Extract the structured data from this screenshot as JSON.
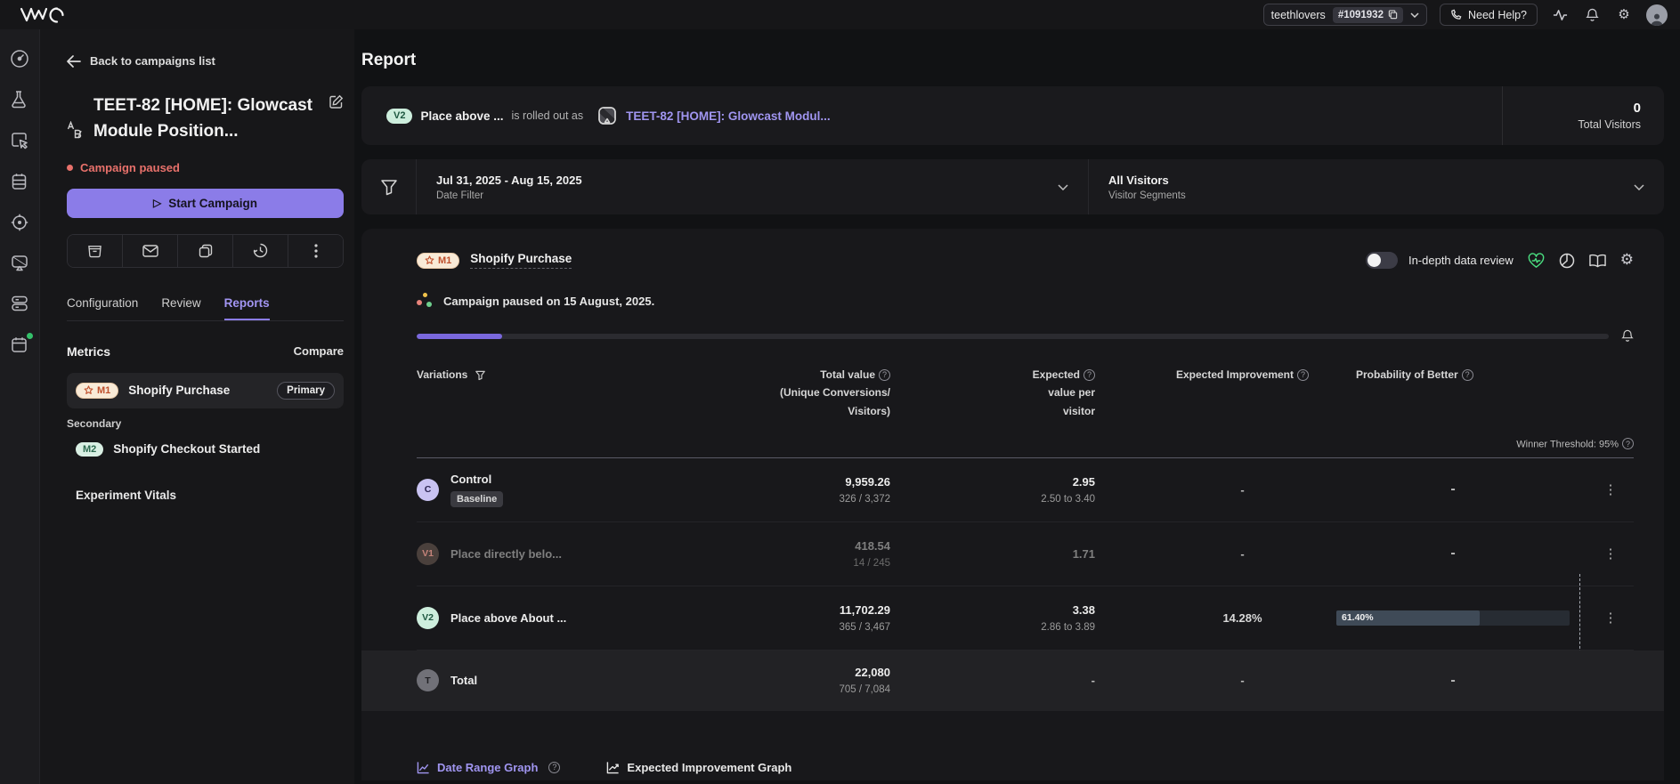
{
  "topbar": {
    "account_name": "teethlovers",
    "account_id": "#1091932",
    "need_help_label": "Need Help?"
  },
  "rail_icons": [
    "dashboard-icon",
    "testing-icon",
    "insights-icon",
    "plans-icon",
    "personalize-icon",
    "web-rollouts-icon",
    "data360-icon",
    "scheduler-icon"
  ],
  "sidebar": {
    "back_link": "Back to campaigns list",
    "campaign_title": "TEET-82 [HOME]: Glowcast Module Position...",
    "status_label": "Campaign paused",
    "start_button_label": "Start Campaign",
    "tabs": [
      {
        "label": "Configuration"
      },
      {
        "label": "Review"
      },
      {
        "label": "Reports"
      }
    ],
    "metrics_header": "Metrics",
    "compare_label": "Compare",
    "primary_metric": {
      "badge": "M1",
      "name": "Shopify Purchase",
      "tag": "Primary"
    },
    "secondary_label": "Secondary",
    "secondary_metric": {
      "badge": "M2",
      "name": "Shopify Checkout Started"
    },
    "experiment_vitals_label": "Experiment Vitals"
  },
  "main": {
    "page_title": "Report",
    "banner": {
      "badge": "V2",
      "variation_name": "Place above ...",
      "middle_text": "is rolled out as",
      "campaign_link": "TEET-82 [HOME]: Glowcast Modul...",
      "total_visitors_value": "0",
      "total_visitors_label": "Total Visitors"
    },
    "filters": {
      "date_value": "Jul 31, 2025 - Aug 15, 2025",
      "date_label": "Date Filter",
      "segment_value": "All Visitors",
      "segment_label": "Visitor Segments"
    },
    "metric_panel": {
      "badge": "M1",
      "name": "Shopify Purchase",
      "toggle_label": "In-depth data review",
      "status_text": "Campaign paused on 15 August, 2025.",
      "progress_percent": 7.2,
      "winner_threshold": "Winner Threshold: 95%",
      "table": {
        "headers": {
          "variations": "Variations",
          "total_value_l1": "Total value",
          "total_value_l2": "(Unique Conversions/",
          "total_value_l3": "Visitors)",
          "expected_l1": "Expected",
          "expected_l2": "value per",
          "expected_l3": "visitor",
          "improvement": "Expected Improvement",
          "probability": "Probability of Better"
        },
        "rows": [
          {
            "badge": "C",
            "name": "Control",
            "tag": "Baseline",
            "total": "9,959.26",
            "total_sub": "326 / 3,372",
            "expected": "2.95",
            "expected_range": "2.50 to 3.40",
            "improvement": "-",
            "probability": "-"
          },
          {
            "badge": "V1",
            "name": "Place directly belo...",
            "total": "418.54",
            "total_sub": "14 / 245",
            "expected": "1.71",
            "expected_range": "",
            "improvement": "-",
            "probability": "-"
          },
          {
            "badge": "V2",
            "name": "Place above About ...",
            "total": "11,702.29",
            "total_sub": "365 / 3,467",
            "expected": "3.38",
            "expected_range": "2.86 to 3.89",
            "improvement": "14.28%",
            "probability_bar": {
              "label": "61.40%",
              "percent": 61.4
            }
          },
          {
            "badge": "T",
            "name": "Total",
            "total": "22,080",
            "total_sub": "705 / 7,084",
            "expected": "-",
            "improvement": "-",
            "probability": "-"
          }
        ]
      },
      "links": {
        "date_range_graph": "Date Range Graph",
        "expected_improvement_graph": "Expected Improvement Graph"
      }
    }
  },
  "colors": {
    "accent_purple": "#8b7ce8",
    "link_purple": "#a095f0",
    "status_red": "#e8716b",
    "mint_badge_bg": "#cdeedd",
    "m1_badge_bg": "#f8ead7",
    "m1_badge_text": "#bf4f2c",
    "probability_fill": "#3f4a57",
    "favorite_green": "#4ade80"
  }
}
